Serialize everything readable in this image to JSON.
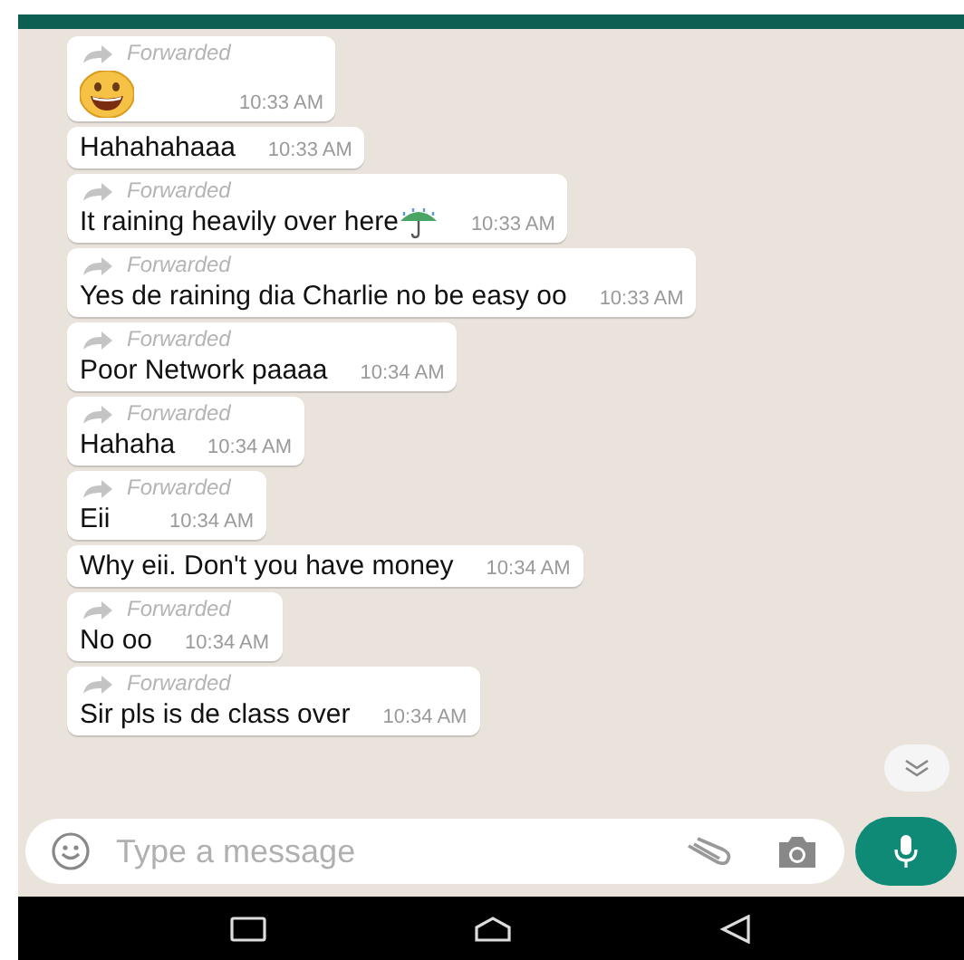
{
  "messages": [
    {
      "kind": "emoji",
      "forwarded": true,
      "label": "Forwarded",
      "time": "10:33 AM"
    },
    {
      "kind": "text",
      "forwarded": false,
      "text": "Hahahahaaa",
      "time": "10:33 AM"
    },
    {
      "kind": "text_icon",
      "forwarded": true,
      "label": "Forwarded",
      "text": "It raining heavily over here",
      "time": "10:33 AM"
    },
    {
      "kind": "text",
      "forwarded": true,
      "label": "Forwarded",
      "text": "Yes de raining dia Charlie no be easy oo",
      "time": "10:33 AM"
    },
    {
      "kind": "text",
      "forwarded": true,
      "label": "Forwarded",
      "text": "Poor Network paaaa",
      "time": "10:34 AM"
    },
    {
      "kind": "text",
      "forwarded": true,
      "label": "Forwarded",
      "text": "Hahaha",
      "time": "10:34 AM"
    },
    {
      "kind": "text",
      "forwarded": true,
      "label": "Forwarded",
      "text": "Eii",
      "time": "10:34 AM"
    },
    {
      "kind": "text",
      "forwarded": false,
      "text": "Why eii. Don't you have money",
      "time": "10:34 AM"
    },
    {
      "kind": "text",
      "forwarded": true,
      "label": "Forwarded",
      "text": "No oo",
      "time": "10:34 AM"
    },
    {
      "kind": "text",
      "forwarded": true,
      "label": "Forwarded",
      "text": "Sir pls is de class over",
      "time": "10:34 AM"
    }
  ],
  "composer": {
    "placeholder": "Type a message"
  }
}
